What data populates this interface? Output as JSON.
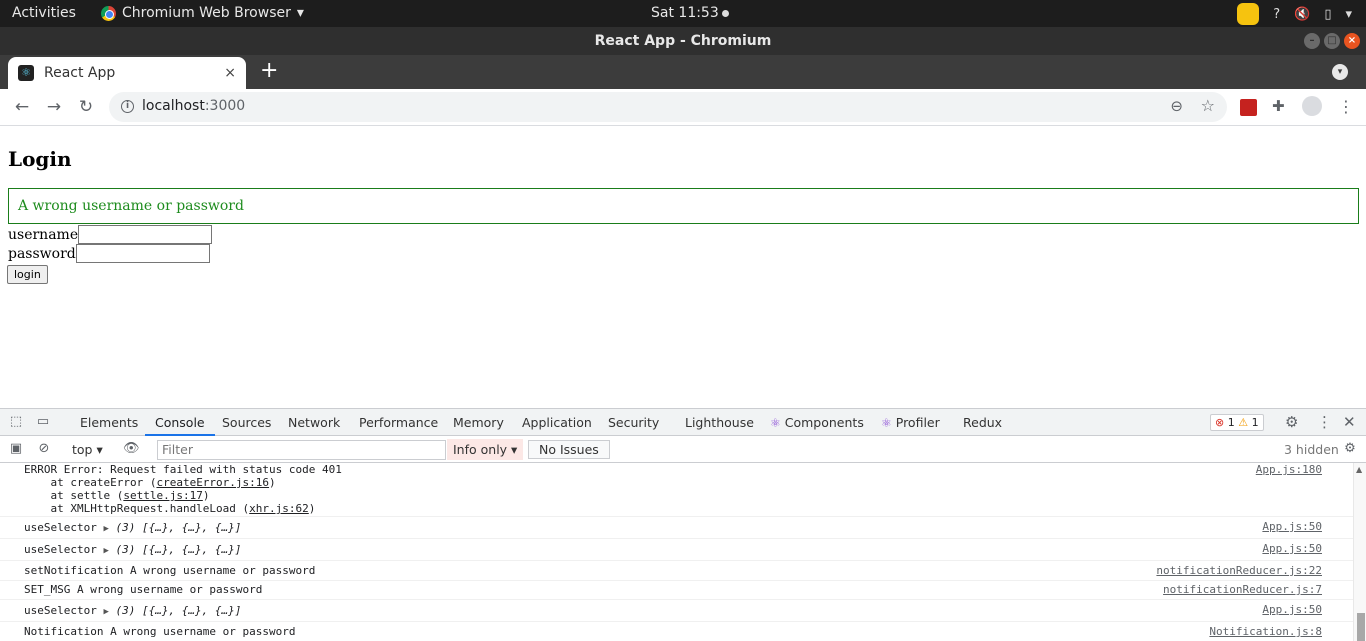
{
  "os_bar": {
    "activities": "Activities",
    "app_name": "Chromium Web Browser",
    "clock": "Sat 11:53",
    "tray_help": "?"
  },
  "window": {
    "title": "React App - Chromium"
  },
  "tab": {
    "title": "React App",
    "close": "×",
    "new_tab": "+"
  },
  "toolbar": {
    "url_host": "localhost",
    "url_port": ":3000",
    "back": "←",
    "forward": "→",
    "reload": "↻"
  },
  "page": {
    "heading": "Login",
    "notification": "A wrong username or password",
    "username_label": "username",
    "password_label": "password",
    "login_button": "login"
  },
  "devtools": {
    "tabs": [
      "Elements",
      "Console",
      "Sources",
      "Network",
      "Performance",
      "Memory",
      "Application",
      "Security",
      "Lighthouse",
      "Components",
      "Profiler",
      "Redux"
    ],
    "active_tab": "Console",
    "error_count": "1",
    "warning_count": "1",
    "context": "top",
    "filter_placeholder": "Filter",
    "levels": "Info only",
    "issues": "No Issues",
    "hidden": "3 hidden"
  },
  "console": {
    "error": {
      "line1": "ERROR Error: Request failed with status code 401",
      "line2_prefix": "    at createError (",
      "line2_link": "createError.js:16",
      "line3_prefix": "    at settle (",
      "line3_link": "settle.js:17",
      "line4_prefix": "    at XMLHttpRequest.handleLoad (",
      "line4_link": "xhr.js:62",
      "close": ")",
      "source": "App.js:180"
    },
    "rows": [
      {
        "label": "useSelector",
        "value": "(3) [{…}, {…}, {…}]",
        "source": "App.js:50"
      },
      {
        "label": "useSelector",
        "value": "(3) [{…}, {…}, {…}]",
        "source": "App.js:50"
      },
      {
        "label": "setNotification A wrong username or password",
        "value": "",
        "source": "notificationReducer.js:22"
      },
      {
        "label": "SET_MSG A wrong username or password",
        "value": "",
        "source": "notificationReducer.js:7"
      },
      {
        "label": "useSelector",
        "value": "(3) [{…}, {…}, {…}]",
        "source": "App.js:50"
      },
      {
        "label": "Notification A wrong username or password",
        "value": "",
        "source": "Notification.js:8"
      }
    ]
  }
}
